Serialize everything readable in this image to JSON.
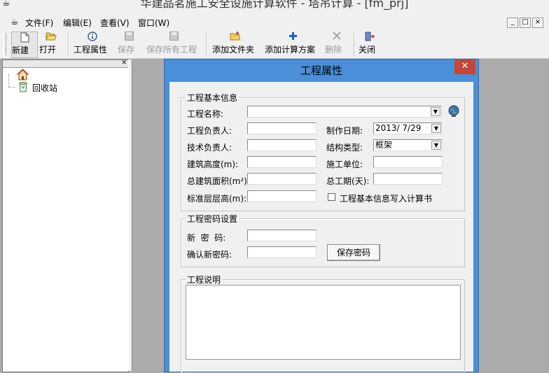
{
  "window": {
    "title": "华建品茗施工安全设施计算软件 - 塔吊计算 - [fm_prj]"
  },
  "menu": {
    "items": [
      "文件(F)",
      "编辑(E)",
      "查看(V)",
      "窗口(W)"
    ],
    "mdi_controls": [
      "_",
      "□",
      "×"
    ]
  },
  "toolbar": {
    "new_label": "新建",
    "open_label": "打开",
    "props_label": "工程属性",
    "save_label": "保存",
    "save_all_label": "保存所有工程",
    "add_folder_label": "添加文件夹",
    "add_plan_label": "添加计算方案",
    "delete_label": "删除",
    "close_label": "关闭"
  },
  "tree": {
    "recycle_label": "回收站"
  },
  "dialog": {
    "title": "工程属性",
    "basic": {
      "legend": "工程基本信息",
      "name_label": "工程名称:",
      "name_value": "",
      "owner_label": "工程负责人:",
      "owner_value": "",
      "tech_label": "技术负责人:",
      "tech_value": "",
      "height_label": "建筑高度(m):",
      "height_value": "",
      "area_label": "总建筑面积(m²)",
      "area_value": "",
      "floor_height_label": "标准层层高(m):",
      "floor_height_value": "",
      "date_label": "制作日期:",
      "date_value": "2013/ 7/29",
      "structure_label": "结构类型:",
      "structure_value": "框架",
      "builder_label": "施工单位:",
      "builder_value": "",
      "duration_label": "总工期(天):",
      "duration_value": "",
      "write_label": "工程基本信息写入计算书",
      "write_checked": false
    },
    "password": {
      "legend": "工程密码设置",
      "new_label": "新  密  码:",
      "confirm_label": "确认新密码:",
      "save_button": "保存密码"
    },
    "notes": {
      "legend": "工程说明",
      "value": ""
    }
  }
}
